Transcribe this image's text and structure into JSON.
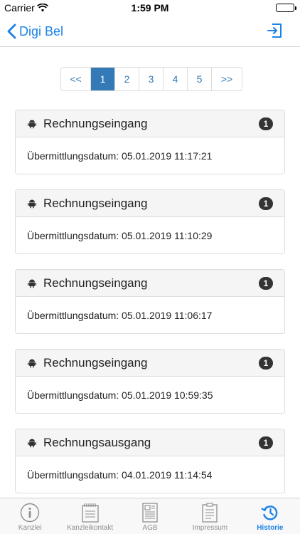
{
  "status": {
    "carrier": "Carrier",
    "time": "1:59 PM"
  },
  "nav": {
    "back_label": "Digi Bel"
  },
  "pagination": {
    "prev": "<<",
    "next": ">>",
    "pages": [
      "1",
      "2",
      "3",
      "4",
      "5"
    ],
    "active": "1"
  },
  "cards": [
    {
      "title": "Rechnungseingang",
      "badge": "1",
      "body": "Übermittlungsdatum: 05.01.2019 11:17:21"
    },
    {
      "title": "Rechnungseingang",
      "badge": "1",
      "body": "Übermittlungsdatum: 05.01.2019 11:10:29"
    },
    {
      "title": "Rechnungseingang",
      "badge": "1",
      "body": "Übermittlungsdatum: 05.01.2019 11:06:17"
    },
    {
      "title": "Rechnungseingang",
      "badge": "1",
      "body": "Übermittlungsdatum: 05.01.2019 10:59:35"
    },
    {
      "title": "Rechnungsausgang",
      "badge": "1",
      "body": "Übermittlungsdatum: 04.01.2019 11:14:54"
    }
  ],
  "tabs": [
    {
      "label": "Kanzlei",
      "icon": "info-icon"
    },
    {
      "label": "Kanzleikontakt",
      "icon": "notepad-icon"
    },
    {
      "label": "AGB",
      "icon": "document-icon"
    },
    {
      "label": "Impressum",
      "icon": "clipboard-icon"
    },
    {
      "label": "Historie",
      "icon": "history-icon"
    }
  ],
  "active_tab": "Historie",
  "colors": {
    "accent": "#1a82e6",
    "pagination_active": "#337ab7",
    "badge": "#333333"
  }
}
